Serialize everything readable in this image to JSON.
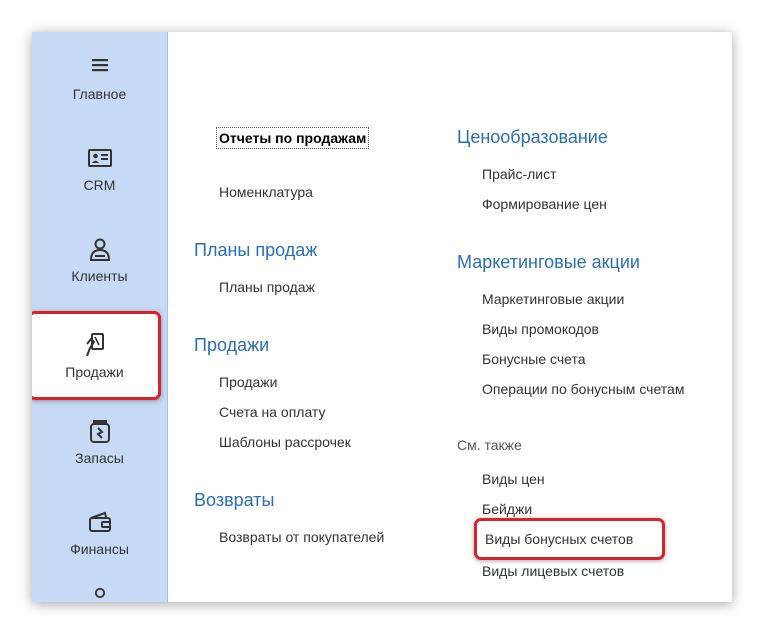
{
  "sidebar": {
    "items": [
      {
        "label": "Главное",
        "icon": "menu-icon"
      },
      {
        "label": "CRM",
        "icon": "contact-card-icon"
      },
      {
        "label": "Клиенты",
        "icon": "person-icon"
      },
      {
        "label": "Продажи",
        "icon": "sales-hand-icon"
      },
      {
        "label": "Запасы",
        "icon": "stock-jar-icon"
      },
      {
        "label": "Финансы",
        "icon": "wallet-icon"
      }
    ]
  },
  "left_column": {
    "top_links": [
      "Отчеты по продажам",
      "Номенклатура"
    ],
    "groups": [
      {
        "title": "Планы продаж",
        "links": [
          "Планы продаж"
        ]
      },
      {
        "title": "Продажи",
        "links": [
          "Продажи",
          "Счета на оплату",
          "Шаблоны рассрочек"
        ]
      },
      {
        "title": "Возвраты",
        "links": [
          "Возвраты от покупателей"
        ]
      }
    ]
  },
  "right_column": {
    "groups": [
      {
        "title": "Ценообразование",
        "links": [
          "Прайс-лист",
          "Формирование цен"
        ]
      },
      {
        "title": "Маркетинговые акции",
        "links": [
          "Маркетинговые акции",
          "Виды промокодов",
          "Бонусные счета",
          "Операции по бонусным счетам"
        ]
      }
    ],
    "see_also": {
      "title": "См. также",
      "links": [
        "Виды цен",
        "Бейджи",
        "Виды бонусных счетов",
        "Виды лицевых счетов"
      ]
    }
  },
  "colors": {
    "accent": "#2a6fb6",
    "highlight_border": "#d8232a",
    "sidebar_bg": "#c6daf6"
  }
}
